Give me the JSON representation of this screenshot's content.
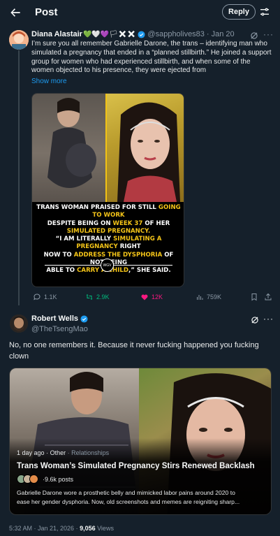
{
  "header": {
    "title": "Post",
    "reply_label": "Reply"
  },
  "post": {
    "author_name": "Diana Alastair",
    "author_emoji": "💚🤍💜🏳✖✖",
    "handle": "@sappholives83",
    "date": "· Jan 20",
    "more": "···",
    "text": "I’m sure you all remember Gabrielle Darone, the trans – identifying man who simulated a pregnancy that ended in a “planned stillbirth.” He joined a support group for women who had experienced stillbirth, and when some of the women objected to his presence, they were ejected from",
    "show_more": "Show more",
    "media": {
      "line1a": "TRANS WOMAN PRAISED FOR STILL ",
      "line1b": "GOING TO WORK",
      "line2a": "DESPITE BEING ON ",
      "line2b": "WEEK 37",
      "line2c": " OF HER",
      "line3": "SIMULATED PREGNANCY.",
      "line4a": "“I AM LITERALLY ",
      "line4b": "SIMULATING A PREGNANCY",
      "line4c": " RIGHT",
      "line5a": "NOW TO ",
      "line5b": "ADDRESS THE DYSPHORIA",
      "line5c": " OF NOT BEING",
      "line6a": "ABLE TO ",
      "line6b": "CARRY A CHILD",
      "line6c": ",” SHE SAID.",
      "logo": "WGV"
    },
    "stats": {
      "replies": "1.1K",
      "reposts": "2.9K",
      "likes": "12K",
      "views": "759K"
    },
    "colors": {
      "repost": "#00ba7c",
      "like": "#f91880",
      "accent": "#1d9bf0"
    }
  },
  "reply": {
    "author_name": "Robert Wells",
    "handle": "@TheTsengMao",
    "text": "No, no one remembers it. Because it never fucking happened you fucking clown",
    "card": {
      "age": "1 day ago",
      "category": "Other",
      "subcategory": "Relationships",
      "title": "Trans Woman’s Simulated Pregnancy Stirs Renewed Backlash",
      "posts": "9.6k posts",
      "description_line1": "Gabrielle Darone wore a prosthetic belly and mimicked labor pains around 2020 to",
      "description_line2": "ease her gender dysphoria. Now, old screenshots and memes are reigniting sharp..."
    },
    "footer": {
      "time": "5:32 AM · Jan 21, 2026 · ",
      "views_count": "9,056",
      "views_label": " Views"
    }
  }
}
